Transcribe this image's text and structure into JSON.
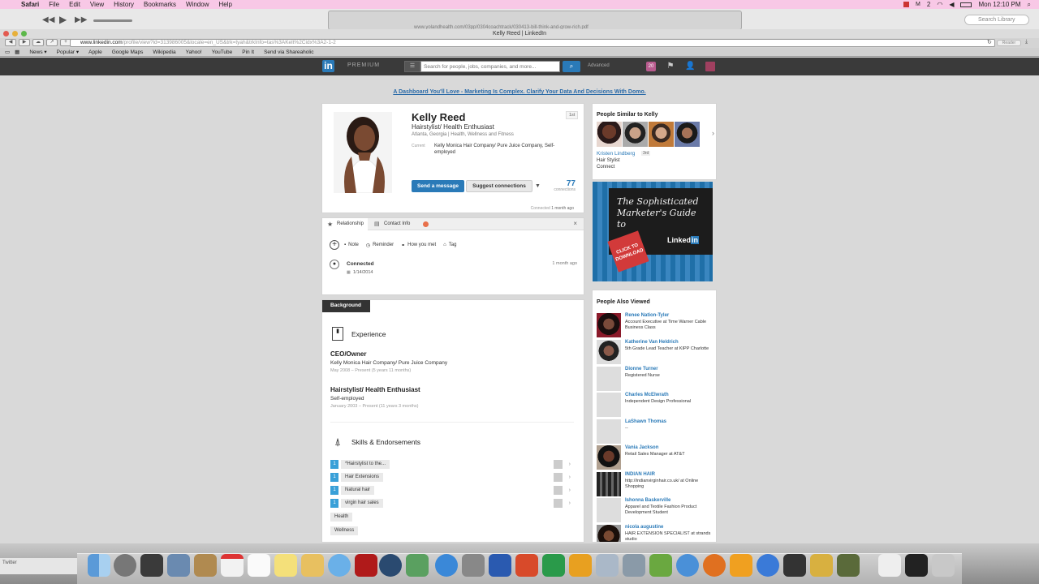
{
  "menubar": {
    "app": "Safari",
    "items": [
      "File",
      "Edit",
      "View",
      "History",
      "Bookmarks",
      "Window",
      "Help"
    ],
    "clock": "Mon 12:10 PM",
    "status_text": "2"
  },
  "bgwindow": {
    "search_placeholder": "Search Library",
    "pdf_title": "www.yolandhealth.com/03pp/0304coachtrack/030413-bill-think-and-grow-rich.pdf"
  },
  "browser": {
    "title": "Kelly Reed | LinkedIn",
    "url_host": "www.linkedin.com",
    "url_path": "/profile/view?id=313986005&locale=en_US&trk=tyah&trkInfo=tas%3AKelt%2Cidx%3A2-1-2",
    "reader_label": "Reader",
    "bookmarks": [
      "News ▾",
      "Popular ▾",
      "Apple",
      "Google Maps",
      "Wikipedia",
      "Yahoo!",
      "YouTube",
      "Pin It",
      "Send via Shareaholic"
    ]
  },
  "linkedin_header": {
    "logo": "in",
    "premium": "PREMIUM",
    "search_placeholder": "Search for people, jobs, companies, and more...",
    "advanced": "Advanced",
    "notif_count": "20"
  },
  "ad_line": "A Dashboard You'll Love - Marketing Is Complex. Clarify Your Data And Decisions With Domo.",
  "profile": {
    "name": "Kelly Reed",
    "headline": "Hairstylist/ Health Enthusiast",
    "location": "Atlanta, Georgia",
    "industry": "Health, Wellness and Fitness",
    "current_label": "Current",
    "current_value": "Kelly Monica Hair Company/ Pure Juice Company, Self-employed",
    "degree": "1st",
    "send_message": "Send a message",
    "suggest": "Suggest connections",
    "connections_count": "77",
    "connections_label": "connections",
    "connected_label": "Connected",
    "connected_time": "1 month ago"
  },
  "relationship": {
    "tabs": [
      "Relationship",
      "Contact Info"
    ],
    "actions": [
      "Note",
      "Reminder",
      "How you met",
      "Tag"
    ],
    "connected": "Connected",
    "date": "1/14/2014",
    "ago": "1 month ago"
  },
  "background": {
    "tab": "Background",
    "experience_heading": "Experience",
    "jobs": [
      {
        "title": "CEO/Owner",
        "company": "Kelly Monica Hair Company/ Pure Juice Company",
        "dates": "May 2008 – Present (5 years 11 months)"
      },
      {
        "title": "Hairstylist/ Health Enthusiast",
        "company": "Self-employed",
        "dates": "January 2003 – Present (11 years 3 months)"
      }
    ],
    "skills_heading": "Skills & Endorsements",
    "skills": [
      {
        "count": "1",
        "label": "*Hairstylist to the..."
      },
      {
        "count": "1",
        "label": "Hair Extensions"
      },
      {
        "count": "1",
        "label": "Natural hair"
      },
      {
        "count": "1",
        "label": "virgin hair sales"
      },
      {
        "count": "",
        "label": "Health"
      },
      {
        "count": "",
        "label": "Wellness"
      }
    ]
  },
  "similar": {
    "title": "People Similar to Kelly",
    "name": "Kristen Lindberg",
    "degree": "3rd",
    "role": "Hair Stylist",
    "action": "Connect"
  },
  "ad_box": {
    "line1": "The Sophisticated",
    "line2": "Marketer's Guide to",
    "brand_a": "Linked",
    "brand_b": "in",
    "cta": "CLICK TO DOWNLOAD"
  },
  "also_viewed": {
    "title": "People Also Viewed",
    "people": [
      {
        "name": "Renee Nation-Tyler",
        "desc": "Account Executive at Time Warner Cable Business Class"
      },
      {
        "name": "Katherine Van Heldrich",
        "desc": "5th Grade Lead Teacher at KIPP Charlotte"
      },
      {
        "name": "Dionne Turner",
        "desc": "Registered Nurse"
      },
      {
        "name": "Charles McElwrath",
        "desc": "Independent Design Professional"
      },
      {
        "name": "LaShawn Thomas",
        "desc": "--"
      },
      {
        "name": "Vania Jackson",
        "desc": "Retail Sales Manager at AT&T"
      },
      {
        "name": "INDIAN HAIR",
        "desc": "http://indianvirginhair.co.uk/ at Online Shopping"
      },
      {
        "name": "Ishonna Baskerville",
        "desc": "Apparel and Textile Fashion Product Development Student"
      },
      {
        "name": "nicola augustine",
        "desc": "HAIR EXTENSION SPECIALIST at strands studio"
      }
    ]
  },
  "dock_left": "Twitter"
}
